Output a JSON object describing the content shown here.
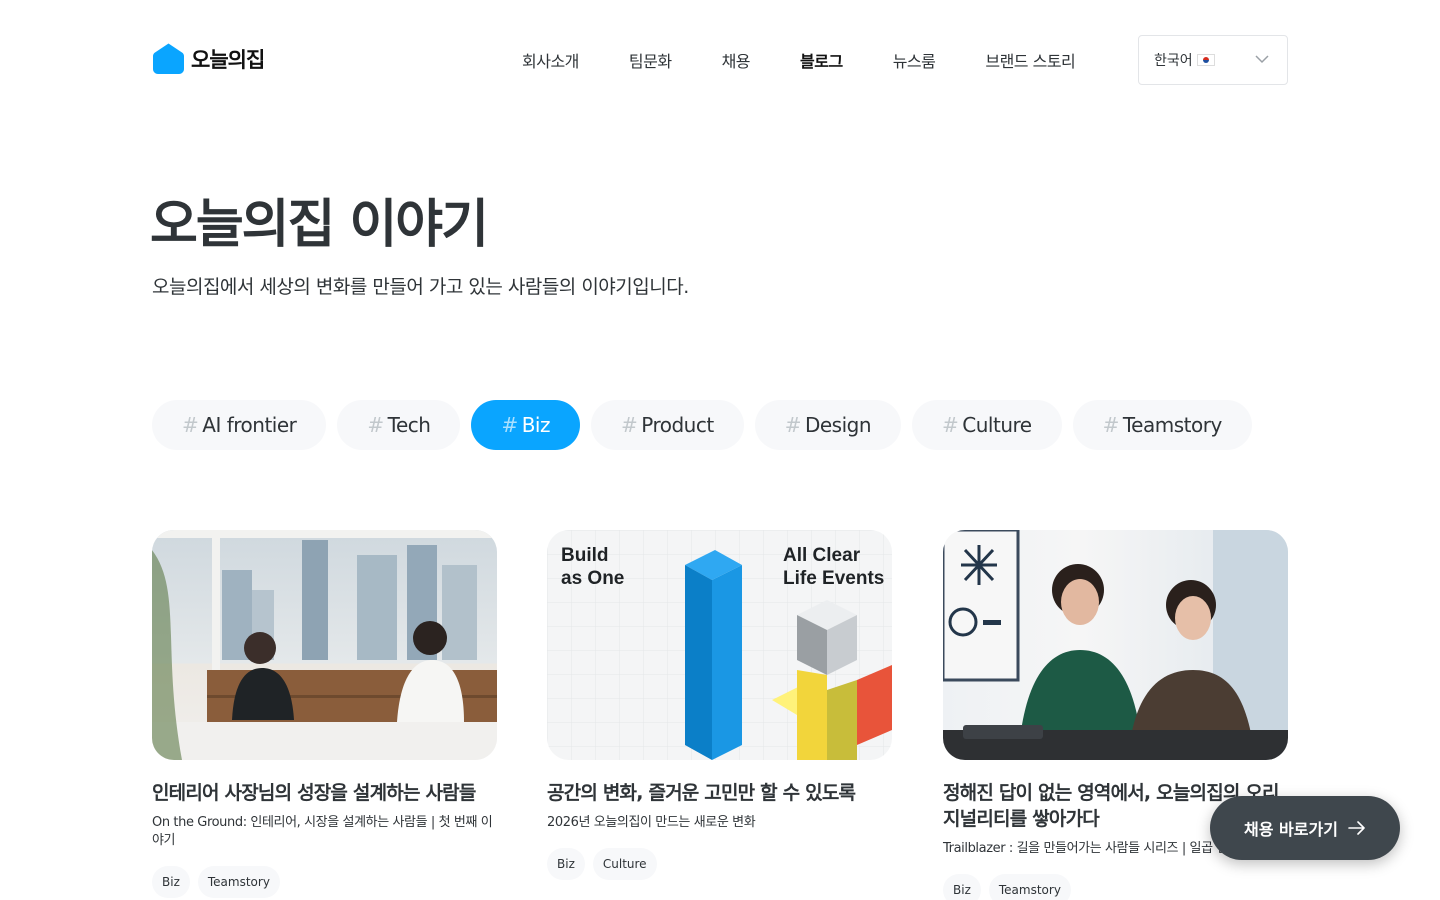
{
  "brand": {
    "name": "오늘의집",
    "accent": "#0aa5ff"
  },
  "nav": {
    "items": [
      {
        "label": "회사소개"
      },
      {
        "label": "팀문화"
      },
      {
        "label": "채용"
      },
      {
        "label": "블로그",
        "active": true
      },
      {
        "label": "뉴스룸"
      },
      {
        "label": "브랜드 스토리"
      }
    ],
    "language": {
      "selected": "한국어",
      "icon": "flag-kr-icon"
    }
  },
  "hero": {
    "title": "오늘의집 이야기",
    "subtitle": "오늘의집에서 세상의 변화를 만들어 가고 있는 사람들의 이야기입니다."
  },
  "filters": {
    "hash": "#",
    "items": [
      {
        "label": "AI frontier"
      },
      {
        "label": "Tech"
      },
      {
        "label": "Biz",
        "active": true
      },
      {
        "label": "Product"
      },
      {
        "label": "Design"
      },
      {
        "label": "Culture"
      },
      {
        "label": "Teamstory"
      }
    ]
  },
  "cards": [
    {
      "title": "인테리어 사장님의 성장을 설계하는 사람들",
      "description": "On the Ground: 인테리어, 시장을 설계하는 사람들 | 첫 번째 이야기",
      "tags": [
        "Biz",
        "Teamstory"
      ],
      "image": "two-men-meeting-photo"
    },
    {
      "title": "공간의 변화, 즐거운 고민만 할 수 있도록",
      "description": "2026년 오늘의집이 만드는 새로운 변화",
      "tags": [
        "Biz",
        "Culture"
      ],
      "image_text": {
        "left": "Build\nas One",
        "right": "All Clear\nLife Events"
      }
    },
    {
      "title": "정해진 답이 없는 영역에서, 오늘의집의 오리지널리티를 쌓아가다",
      "description": "Trailblazer : 길을 만들어가는 사람들 시리즈 | 일곱 번째 이야기",
      "tags": [
        "Biz",
        "Teamstory"
      ],
      "image": "two-women-smiling-photo"
    }
  ],
  "cta": {
    "label": "채용 바로가기",
    "icon": "arrow-right-icon"
  }
}
